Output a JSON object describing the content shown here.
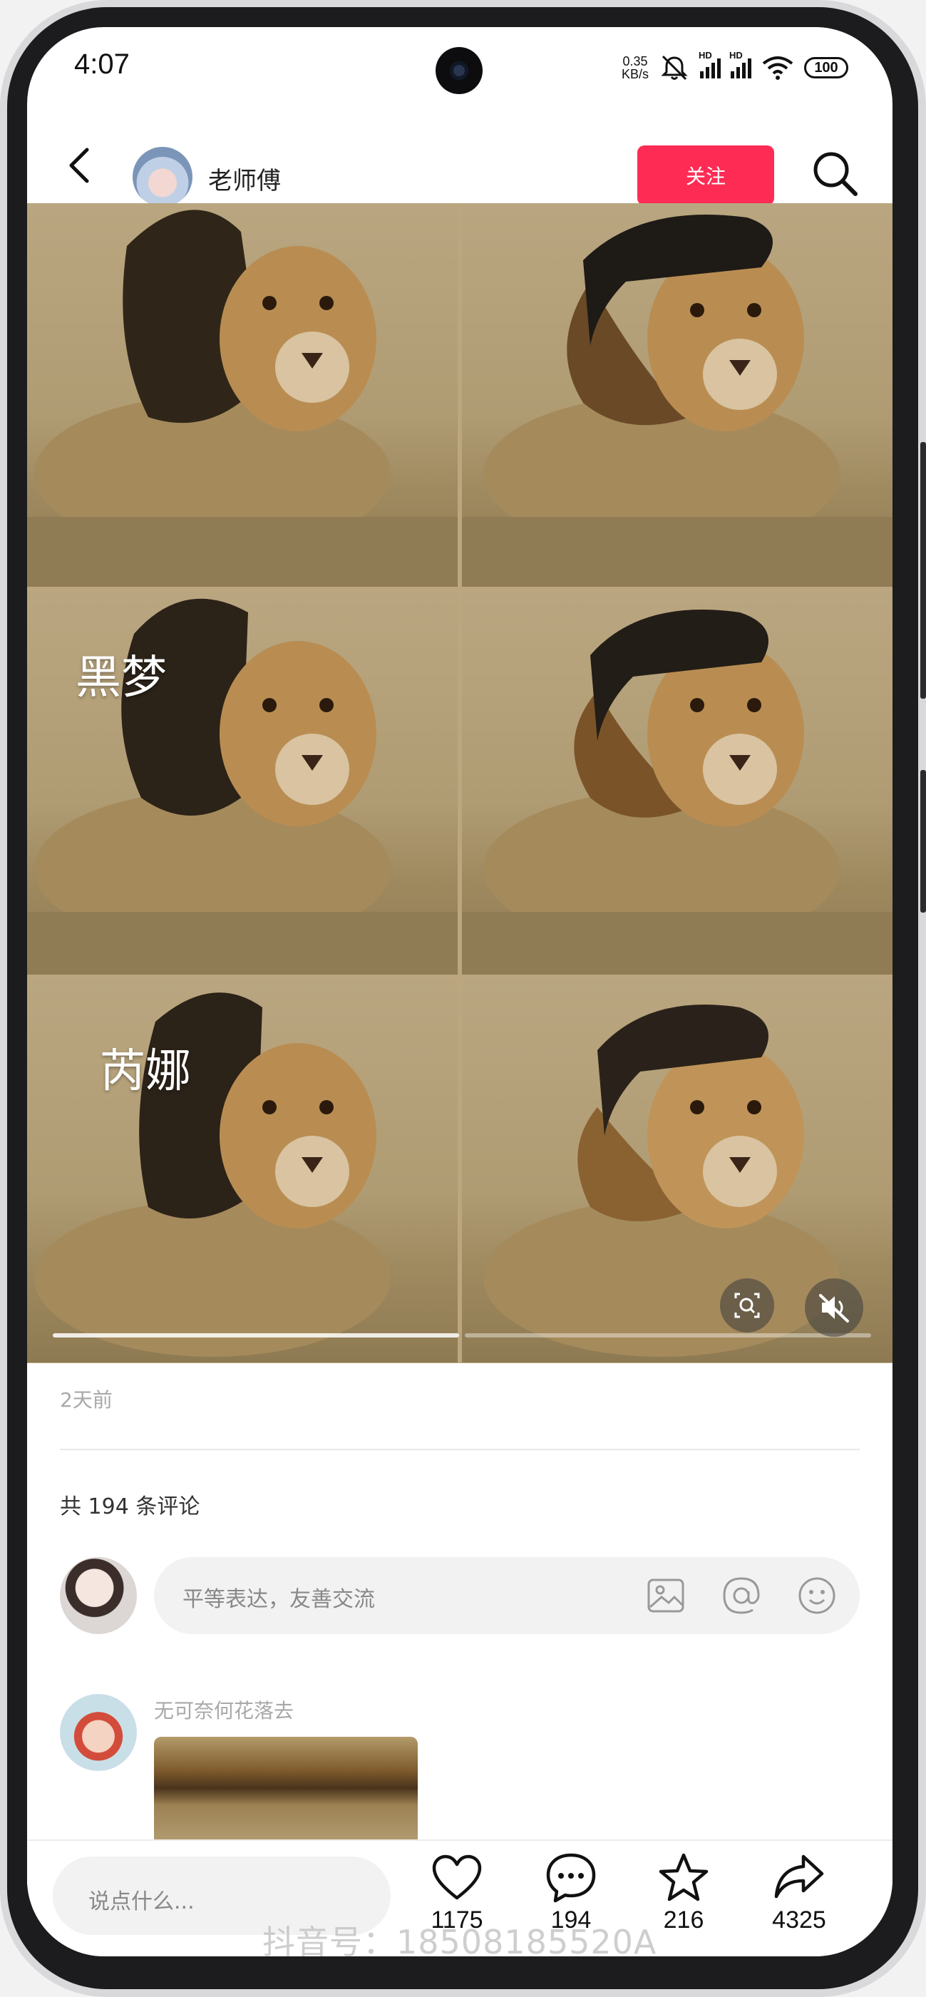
{
  "status_bar": {
    "time": "4:07",
    "net_speed_value": "0.35",
    "net_speed_unit": "KB/s",
    "network_1": "HD",
    "network_2": "HD",
    "battery": "100"
  },
  "header": {
    "username": "老师傅",
    "follow_label": "关注"
  },
  "media": {
    "labels": [
      "黑梦",
      "芮娜"
    ],
    "image_count": 2,
    "current_image": 1
  },
  "post": {
    "posted_time": "2天前",
    "comment_count_text": "共 194 条评论"
  },
  "comment_input": {
    "placeholder": "平等表达，友善交流"
  },
  "comments": [
    {
      "author": "无可奈何花落去"
    }
  ],
  "bottom_bar": {
    "say_placeholder": "说点什么...",
    "likes": "1175",
    "comments": "194",
    "favorites": "216",
    "shares": "4325"
  },
  "watermark": "抖音号：18508185520A",
  "colors": {
    "accent": "#fe2c55",
    "muted_text": "#a8a8a8"
  }
}
